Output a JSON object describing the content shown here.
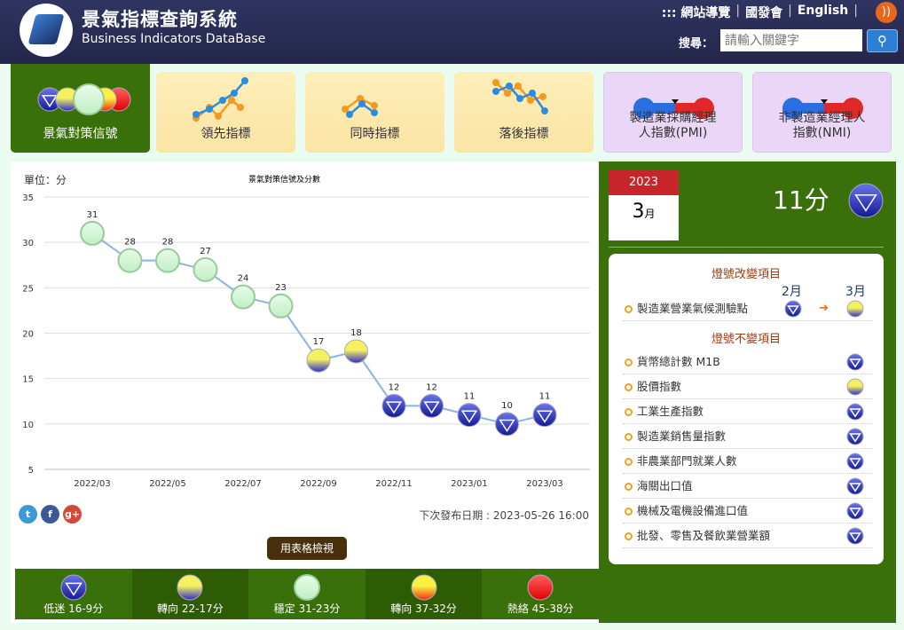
{
  "header": {
    "title": "景氣指標查詢系統",
    "subtitle": "Business Indicators DataBase",
    "links": [
      "::: 網站導覽",
      "國發會",
      "English"
    ],
    "search_label": "搜尋：",
    "search_placeholder": "請輸入關鍵字",
    "icons": [
      "rss-icon",
      "search-icon"
    ]
  },
  "tabs": [
    {
      "label": "景氣對策信號",
      "active": true
    },
    {
      "label": "領先指標"
    },
    {
      "label": "同時指標"
    },
    {
      "label": "落後指標"
    },
    {
      "label": "製造業採購經理人指數(PMI)"
    },
    {
      "label": "非製造業經理人指數(NMI)"
    }
  ],
  "chart_data": {
    "type": "line",
    "title": "景氣對策信號及分數",
    "ylabel": "單位：分",
    "ylim": [
      5,
      35
    ],
    "yticks": [
      5,
      10,
      15,
      20,
      25,
      30,
      35
    ],
    "grid": true,
    "x": [
      "2022/03",
      "2022/04",
      "2022/05",
      "2022/06",
      "2022/07",
      "2022/08",
      "2022/09",
      "2022/10",
      "2022/11",
      "2022/12",
      "2023/01",
      "2023/02",
      "2023/03"
    ],
    "xtick_labels": [
      "2022/03",
      "2022/05",
      "2022/07",
      "2022/09",
      "2022/11",
      "2023/01",
      "2023/03"
    ],
    "values": [
      31,
      28,
      28,
      27,
      24,
      23,
      17,
      18,
      12,
      12,
      11,
      10,
      11
    ],
    "signals": [
      "green",
      "green",
      "green",
      "green",
      "green",
      "green",
      "yellow-blue",
      "yellow-blue",
      "blue",
      "blue",
      "blue",
      "blue",
      "blue"
    ],
    "line_color": "#8ab4e0"
  },
  "release": "下次發布日期 : 2023-05-26 16:00",
  "table_button": "用表格檢視",
  "legend": [
    {
      "label": "低迷 16-9分",
      "signal": "blue"
    },
    {
      "label": "轉向 22-17分",
      "signal": "yellow-blue"
    },
    {
      "label": "穩定 31-23分",
      "signal": "green"
    },
    {
      "label": "轉向 37-32分",
      "signal": "yellow-red"
    },
    {
      "label": "熱絡 45-38分",
      "signal": "red"
    }
  ],
  "current": {
    "year": "2023",
    "month": "3",
    "month_unit": "月",
    "score": "11分",
    "signal": "blue"
  },
  "changed": {
    "title": "燈號改變項目",
    "prev": "2月",
    "curr": "3月",
    "items": [
      {
        "name": "製造業營業氣候測驗點",
        "from": "blue",
        "to": "yellow-blue"
      }
    ]
  },
  "unchanged": {
    "title": "燈號不變項目",
    "items": [
      {
        "name": "貨幣總計數 M1B",
        "signal": "blue"
      },
      {
        "name": "股價指數",
        "signal": "yellow-blue"
      },
      {
        "name": "工業生產指數",
        "signal": "blue"
      },
      {
        "name": "製造業銷售量指數",
        "signal": "blue"
      },
      {
        "name": "非農業部門就業人數",
        "signal": "blue"
      },
      {
        "name": "海關出口值",
        "signal": "blue"
      },
      {
        "name": "機械及電機設備進口值",
        "signal": "blue"
      },
      {
        "name": "批發、零售及餐飲業營業額",
        "signal": "blue"
      }
    ]
  },
  "colors": {
    "header": "#262a4e",
    "green_panel": "#3a7009",
    "tab_yellow": "#fde9ad",
    "tab_purple": "#ead7f7"
  }
}
